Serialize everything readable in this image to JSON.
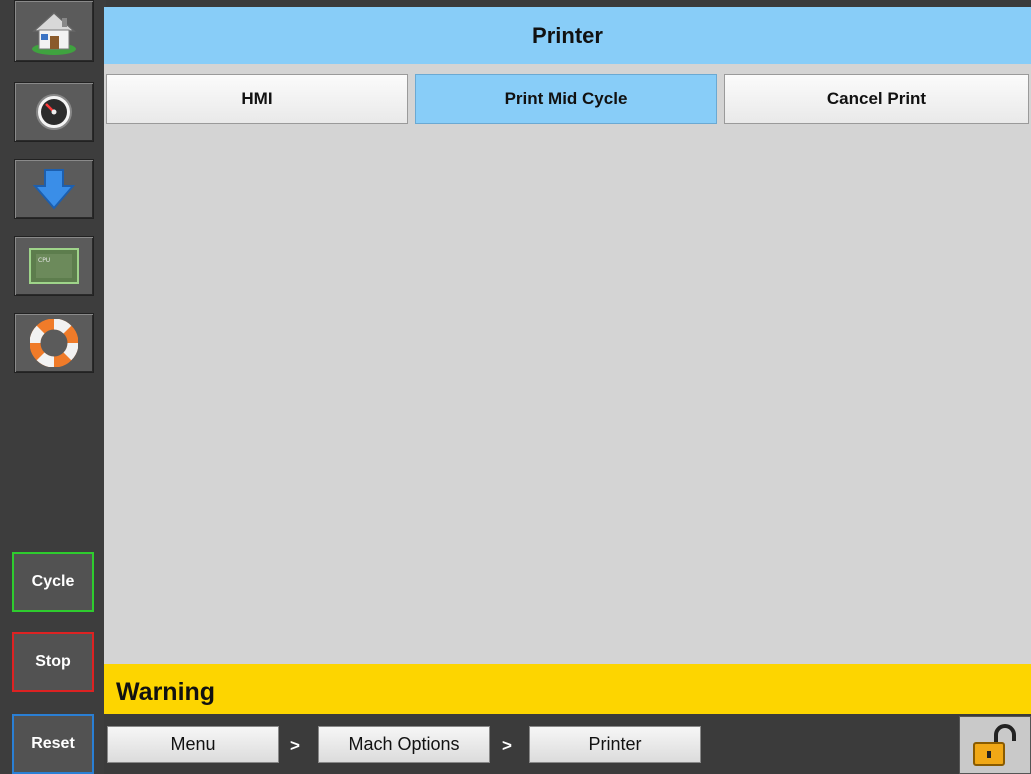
{
  "header": {
    "title": "Printer"
  },
  "sidebar": {
    "icons": [
      "home-icon",
      "gauge-icon",
      "download-arrow-icon",
      "cpu-icon",
      "lifebuoy-icon"
    ],
    "cpu_chip_text": "CPU"
  },
  "tabs": [
    {
      "label": "HMI",
      "active": false
    },
    {
      "label": "Print Mid Cycle",
      "active": true
    },
    {
      "label": "Cancel Print",
      "active": false
    }
  ],
  "controls": {
    "cycle_label": "Cycle",
    "stop_label": "Stop",
    "reset_label": "Reset"
  },
  "warning": {
    "text": "Warning"
  },
  "breadcrumb": {
    "items": [
      "Menu",
      "Mach Options",
      "Printer"
    ],
    "separator": ">"
  },
  "colors": {
    "header": "#88cdf8",
    "warning": "#fdd500",
    "cycle_border": "#2ecc2e",
    "stop_border": "#dd2222",
    "reset_border": "#2a7fd4"
  }
}
